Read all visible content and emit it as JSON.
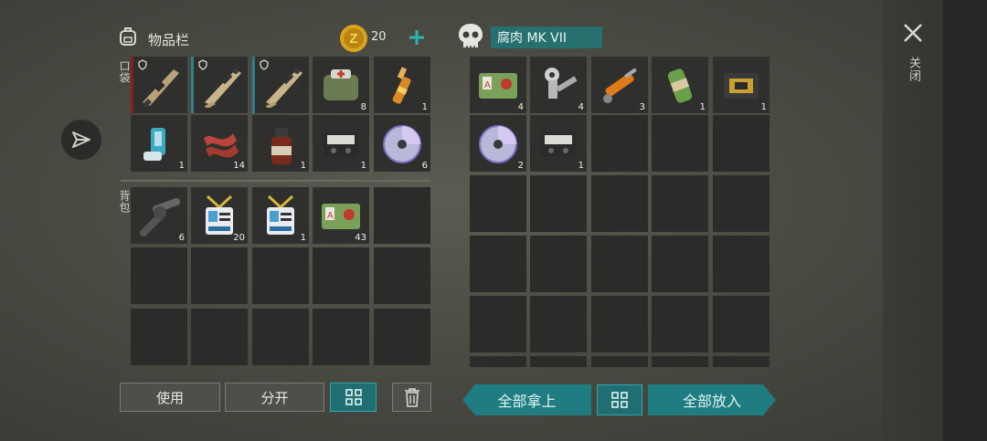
{
  "left_panel": {
    "title": "物品栏",
    "coins": "20",
    "pockets_label": "口袋",
    "backpack_label": "背包",
    "pockets": [
      {
        "icon": "shotgun-icon",
        "count": "",
        "shield": true,
        "bar": "red"
      },
      {
        "icon": "rifle-icon",
        "count": "",
        "shield": true,
        "bar": "teal"
      },
      {
        "icon": "rifle-icon",
        "count": "",
        "shield": true,
        "bar": "teal"
      },
      {
        "icon": "medkit-bag-icon",
        "count": "8"
      },
      {
        "icon": "ampoule-icon",
        "count": "1"
      },
      {
        "icon": "inhaler-icon",
        "count": "1"
      },
      {
        "icon": "bacon-icon",
        "count": "14"
      },
      {
        "icon": "medicine-bottle-icon",
        "count": "1"
      },
      {
        "icon": "vhs-tape-icon",
        "count": "1"
      },
      {
        "icon": "cd-disc-icon",
        "count": "6"
      }
    ],
    "backpack": [
      {
        "icon": "pipe-fitting-icon",
        "count": "6"
      },
      {
        "icon": "id-badge-icon",
        "count": "20"
      },
      {
        "icon": "id-badge-icon",
        "count": "1"
      },
      {
        "icon": "access-card-icon",
        "count": "43"
      }
    ],
    "buttons": {
      "use": "使用",
      "split": "分开"
    }
  },
  "right_panel": {
    "title": "腐肉 MK VII",
    "items": [
      {
        "icon": "access-card-icon",
        "count": "4"
      },
      {
        "icon": "robot-arm-icon",
        "count": "4"
      },
      {
        "icon": "hydraulic-cylinder-icon",
        "count": "3"
      },
      {
        "icon": "canister-icon",
        "count": "1"
      },
      {
        "icon": "circuit-board-icon",
        "count": "1"
      },
      {
        "icon": "cd-disc-icon",
        "count": "2"
      },
      {
        "icon": "vhs-tape-icon",
        "count": "1"
      }
    ],
    "buttons": {
      "take_all": "全部拿上",
      "put_all": "全部放入"
    }
  },
  "close_label": "关闭",
  "colors": {
    "teal": "#1f7c80",
    "accent_teal": "#2d7f8a",
    "coin": "#d9a51d"
  }
}
